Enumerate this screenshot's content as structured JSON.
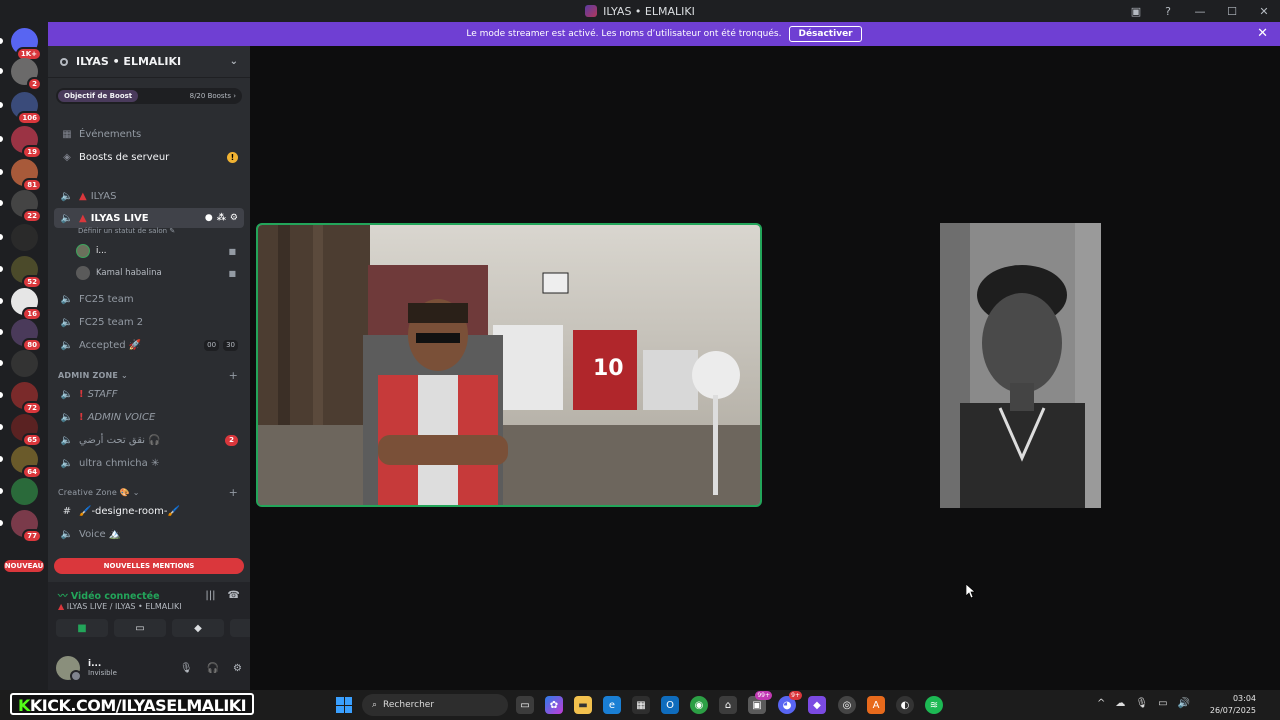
{
  "window": {
    "title": "ILYAS • ELMALIKI",
    "controls": [
      "inbox-icon",
      "help-icon",
      "minimize-icon",
      "maximize-icon",
      "close-icon"
    ]
  },
  "servers": [
    {
      "name": "discord-home",
      "badge": "1K+",
      "color": "#5865f2"
    },
    {
      "name": "server-2",
      "badge": "2",
      "color": "#6b6a6a"
    },
    {
      "name": "server-3",
      "badge": "106",
      "color": "#3a4b7a"
    },
    {
      "name": "server-4",
      "badge": "19",
      "color": "#9b3344"
    },
    {
      "name": "server-5",
      "badge": "81",
      "color": "#a85a3a"
    },
    {
      "name": "server-6",
      "badge": "22",
      "color": "#444"
    },
    {
      "name": "server-7",
      "badge": "",
      "color": "#2a2a2a"
    },
    {
      "name": "server-8",
      "badge": "52",
      "color": "#4b4a2a"
    },
    {
      "name": "server-9",
      "badge": "16",
      "color": "#e6e6e6"
    },
    {
      "name": "server-10",
      "badge": "80",
      "color": "#4a3a5a"
    },
    {
      "name": "server-11",
      "badge": "",
      "color": "#333"
    },
    {
      "name": "server-12",
      "badge": "72",
      "color": "#7a2a2a"
    },
    {
      "name": "server-13",
      "badge": "65",
      "color": "#5a2222"
    },
    {
      "name": "server-14",
      "badge": "64",
      "color": "#6a5a2a"
    },
    {
      "name": "server-15",
      "badge": "",
      "color": "#2a6a3a"
    },
    {
      "name": "server-16",
      "badge": "77",
      "color": "#7a3a4a"
    }
  ],
  "new_label": "NOUVEAU",
  "banner": {
    "text": "Le mode streamer est activé. Les noms d’utilisateur ont été tronqués.",
    "button": "Désactiver"
  },
  "guild": {
    "name": "ILYAS • ELMALIKI",
    "boost_tag": "Objectif de Boost",
    "boost_count": "8/20 Boosts ›"
  },
  "nav": {
    "events": "Événements",
    "boosts": "Boosts de serveur"
  },
  "channels": {
    "ilyas": "ILYAS",
    "ilyas_live": "ILYAS LIVE",
    "ilyas_live_status": "Définir un statut de salon ✎",
    "user1": "i...",
    "user2": "Kamal habalina",
    "fc25": "FC25 team",
    "fc25_2": "FC25 team 2",
    "accepted": "Accepted 🚀",
    "accepted_a": "00",
    "accepted_b": "30",
    "admin_cat": "ADMIN ZONE ⌄",
    "staff": "STAFF",
    "admin_voice": "ADMIN VOICE",
    "arabic": "نقق تحت أرضي 🎧",
    "arabic_badge": "2",
    "ultra": "ultra chmicha ✳",
    "creative_cat": "Creative Zone 🎨 ⌄",
    "designe": "🖌️-designe-room-🖌️",
    "voice": "Voice 🏔️",
    "mentions": "NOUVELLES MENTIONS"
  },
  "voice_panel": {
    "status": "Vidéo connectée",
    "location": "ILYAS LIVE / ILYAS • ELMALIKI"
  },
  "me": {
    "name": "i...",
    "status": "Invisible"
  },
  "taskbar": {
    "kick": "KICK.COM/ILYASELMALIKI",
    "search_placeholder": "Rechercher",
    "badge_1": "99+",
    "badge_2": "9+",
    "time": "03:04",
    "date": "26/07/2025"
  }
}
